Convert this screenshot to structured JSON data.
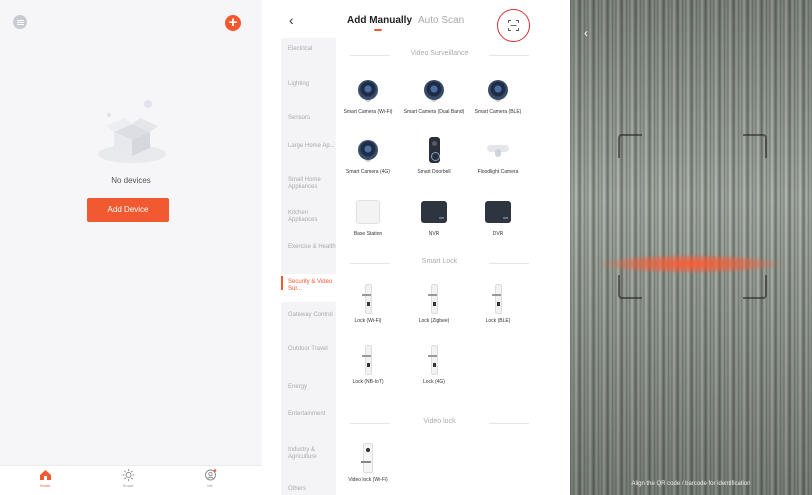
{
  "home": {
    "empty_text": "No devices",
    "add_device_label": "Add Device",
    "tabs": [
      {
        "label": "Home",
        "icon": "house-icon"
      },
      {
        "label": "Smart",
        "icon": "sun-icon"
      },
      {
        "label": "Me",
        "icon": "profile-icon"
      }
    ],
    "accent_color": "#f15a31"
  },
  "add": {
    "tabs": {
      "manual": "Add Manually",
      "scan": "Auto Scan"
    },
    "categories": [
      "Electrical",
      "Lighting",
      "Sensors",
      "Large Home Ap...",
      "Small Home Appliances",
      "Kitchen Appliances",
      "Exercise & Health",
      "Security & Video Sur...",
      "Gateway Control",
      "Outdoor Travel",
      "Energy",
      "Entertainment",
      "Industry & Agriculture",
      "Others"
    ],
    "active_category_index": 7,
    "sections": {
      "video": "Video Surveillance",
      "lock": "Smart Lock",
      "video_lock": "Video lock"
    },
    "devices": {
      "cam_wifi": "Smart Camera (Wi-Fi)",
      "cam_dual": "Smart Camera (Dual Band)",
      "cam_ble": "Smart Camera (BLE)",
      "cam_4g": "Smart Camera (4G)",
      "doorbell": "Smart Doorbell",
      "flood": "Floodlight Camera",
      "base": "Base Station",
      "nvr": "NVR",
      "dvr": "DVR",
      "lock_wifi": "Lock (Wi-Fi)",
      "lock_zigbee": "Lock (Zigbee)",
      "lock_ble": "Lock (BLE)",
      "lock_nbiot": "Lock (NB-IoT)",
      "lock_4g": "Lock (4G)",
      "vlock_wifi": "Video lock (Wi-Fi)"
    }
  },
  "scanner": {
    "hint": "Align the QR code / barcode for identification"
  }
}
